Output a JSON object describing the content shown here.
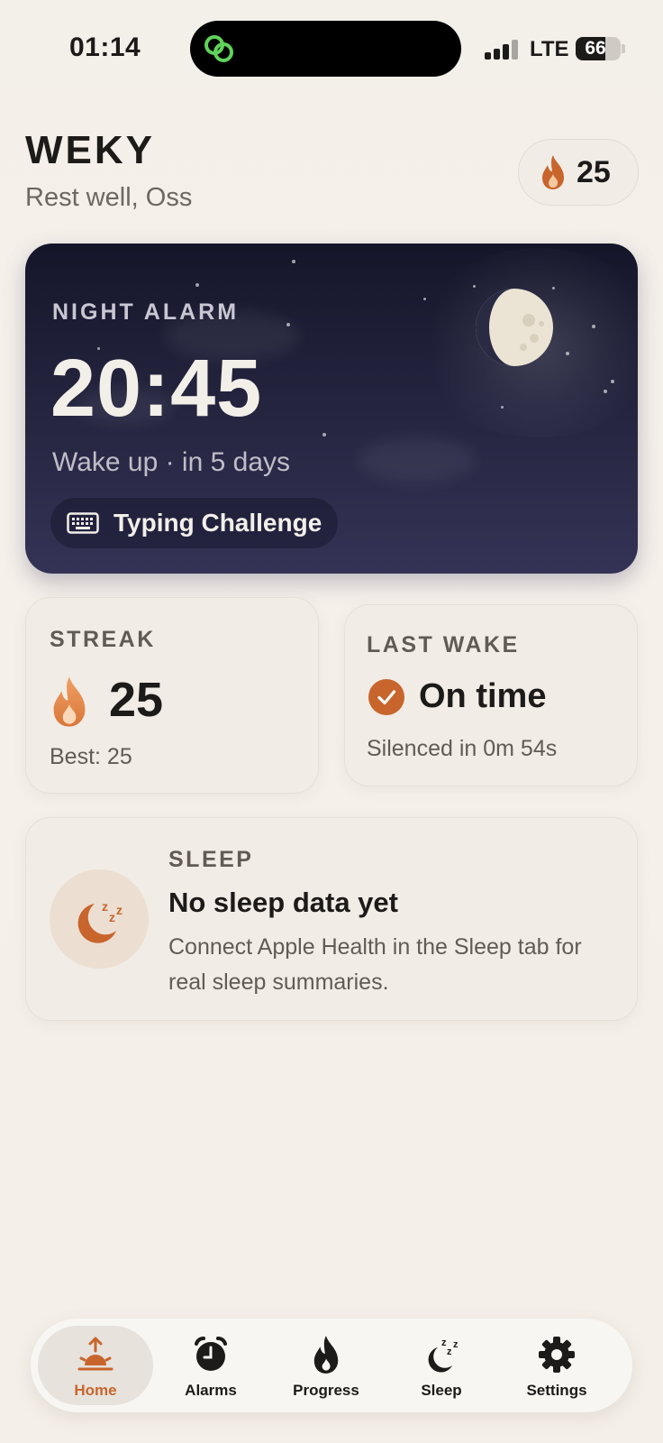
{
  "status_bar": {
    "time": "01:14",
    "network": "LTE",
    "battery": "66",
    "battery_level": 0.66
  },
  "header": {
    "app_title": "WEKY",
    "greeting": "Rest well, Oss",
    "streak_count": "25"
  },
  "night_alarm": {
    "label": "NIGHT ALARM",
    "time": "20:45",
    "subtitle": "Wake up · in 5 days",
    "challenge": "Typing Challenge",
    "challenge_icon": "keyboard-icon"
  },
  "streak_card": {
    "label": "STREAK",
    "value": "25",
    "best": "Best: 25"
  },
  "last_wake_card": {
    "label": "LAST WAKE",
    "status": "On time",
    "detail": "Silenced in 0m 54s"
  },
  "sleep_card": {
    "label": "SLEEP",
    "title": "No sleep data yet",
    "description": "Connect Apple Health in the Sleep tab for real sleep summaries."
  },
  "tabs": [
    {
      "label": "Home",
      "icon": "sunrise-icon",
      "active": true
    },
    {
      "label": "Alarms",
      "icon": "alarm-clock-icon",
      "active": false
    },
    {
      "label": "Progress",
      "icon": "flame-icon",
      "active": false
    },
    {
      "label": "Sleep",
      "icon": "moon-zzz-icon",
      "active": false
    },
    {
      "label": "Settings",
      "icon": "gear-icon",
      "active": false
    }
  ],
  "colors": {
    "accent": "#c8652d",
    "background": "#f4efe8",
    "card_background": "#f1ece6",
    "night_card_top": "#15152a",
    "night_card_bottom": "#343356",
    "island_icon": "#5fd35a"
  }
}
